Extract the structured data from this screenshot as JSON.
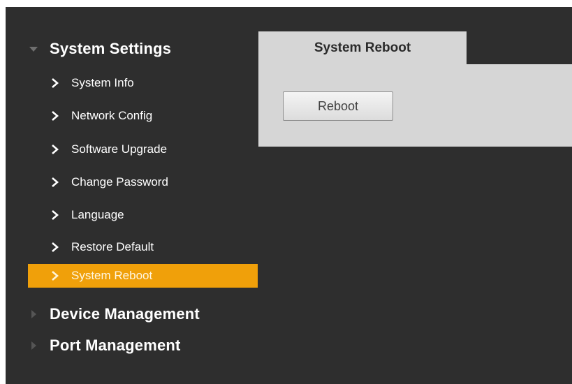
{
  "sidebar": {
    "groups": [
      {
        "label": "System Settings",
        "expanded": true,
        "items": [
          {
            "label": "System Info"
          },
          {
            "label": "Network Config"
          },
          {
            "label": "Software Upgrade"
          },
          {
            "label": "Change Password"
          },
          {
            "label": "Language"
          },
          {
            "label": "Restore Default"
          },
          {
            "label": "System Reboot",
            "active": true
          }
        ]
      },
      {
        "label": "Device Management",
        "expanded": false
      },
      {
        "label": "Port Management",
        "expanded": false
      }
    ]
  },
  "main": {
    "tab": {
      "label": "System Reboot"
    },
    "reboot_button": {
      "label": "Reboot"
    }
  },
  "icons": {
    "expanded": "triangle-down-icon",
    "collapsed": "triangle-right-icon",
    "item": "chevron-right-icon"
  },
  "colors": {
    "background": "#2e2e2e",
    "active_item": "#f0a00a",
    "panel": "#d6d6d6"
  }
}
